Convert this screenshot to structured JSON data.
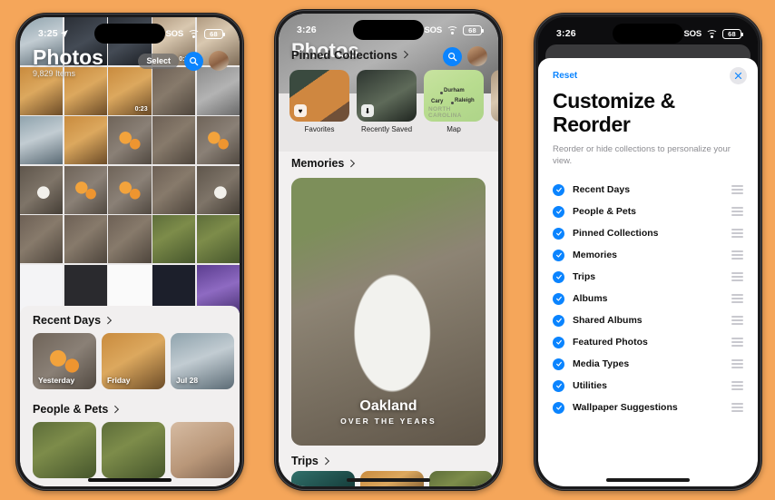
{
  "background_color": "#F5A65A",
  "accent_blue": "#0A84FF",
  "phone1": {
    "status": {
      "time": "3:25",
      "sos": "SOS",
      "battery": "68"
    },
    "header": {
      "title": "Photos",
      "subtitle": "9,829 Items",
      "select_label": "Select"
    },
    "grid_badges": [
      "0:51",
      "0:23"
    ],
    "sections": [
      {
        "title": "Recent Days",
        "cards": [
          {
            "label": "Yesterday"
          },
          {
            "label": "Friday"
          },
          {
            "label": "Jul 28"
          },
          {
            "label": ""
          }
        ]
      },
      {
        "title": "People & Pets",
        "cards": []
      }
    ]
  },
  "phone2": {
    "status": {
      "time": "3:26",
      "sos": "SOS",
      "battery": "68"
    },
    "header": {
      "title": "Photos"
    },
    "pinned": {
      "title": "Pinned Collections",
      "items": [
        {
          "caption": "Favorites",
          "badge": "♥"
        },
        {
          "caption": "Recently Saved",
          "badge": "⬇"
        },
        {
          "caption": "Map",
          "badge": ""
        }
      ],
      "map_labels": [
        "Durham",
        "Raleigh",
        "Cary",
        "NORTH CAROLINA"
      ]
    },
    "memories": {
      "title": "Memories",
      "card_title": "Oakland",
      "card_subtitle": "OVER THE YEARS"
    },
    "trips": {
      "title": "Trips"
    }
  },
  "phone3": {
    "status": {
      "time": "3:26",
      "sos": "SOS",
      "battery": "68"
    },
    "sheet": {
      "reset_label": "Reset",
      "close_label": "✕",
      "title": "Customize & Reorder",
      "description": "Reorder or hide collections to personalize your view.",
      "options": [
        {
          "label": "Recent Days",
          "checked": true
        },
        {
          "label": "People & Pets",
          "checked": true
        },
        {
          "label": "Pinned Collections",
          "checked": true
        },
        {
          "label": "Memories",
          "checked": true
        },
        {
          "label": "Trips",
          "checked": true
        },
        {
          "label": "Albums",
          "checked": true
        },
        {
          "label": "Shared Albums",
          "checked": true
        },
        {
          "label": "Featured Photos",
          "checked": true
        },
        {
          "label": "Media Types",
          "checked": true
        },
        {
          "label": "Utilities",
          "checked": true
        },
        {
          "label": "Wallpaper Suggestions",
          "checked": true
        }
      ]
    }
  }
}
